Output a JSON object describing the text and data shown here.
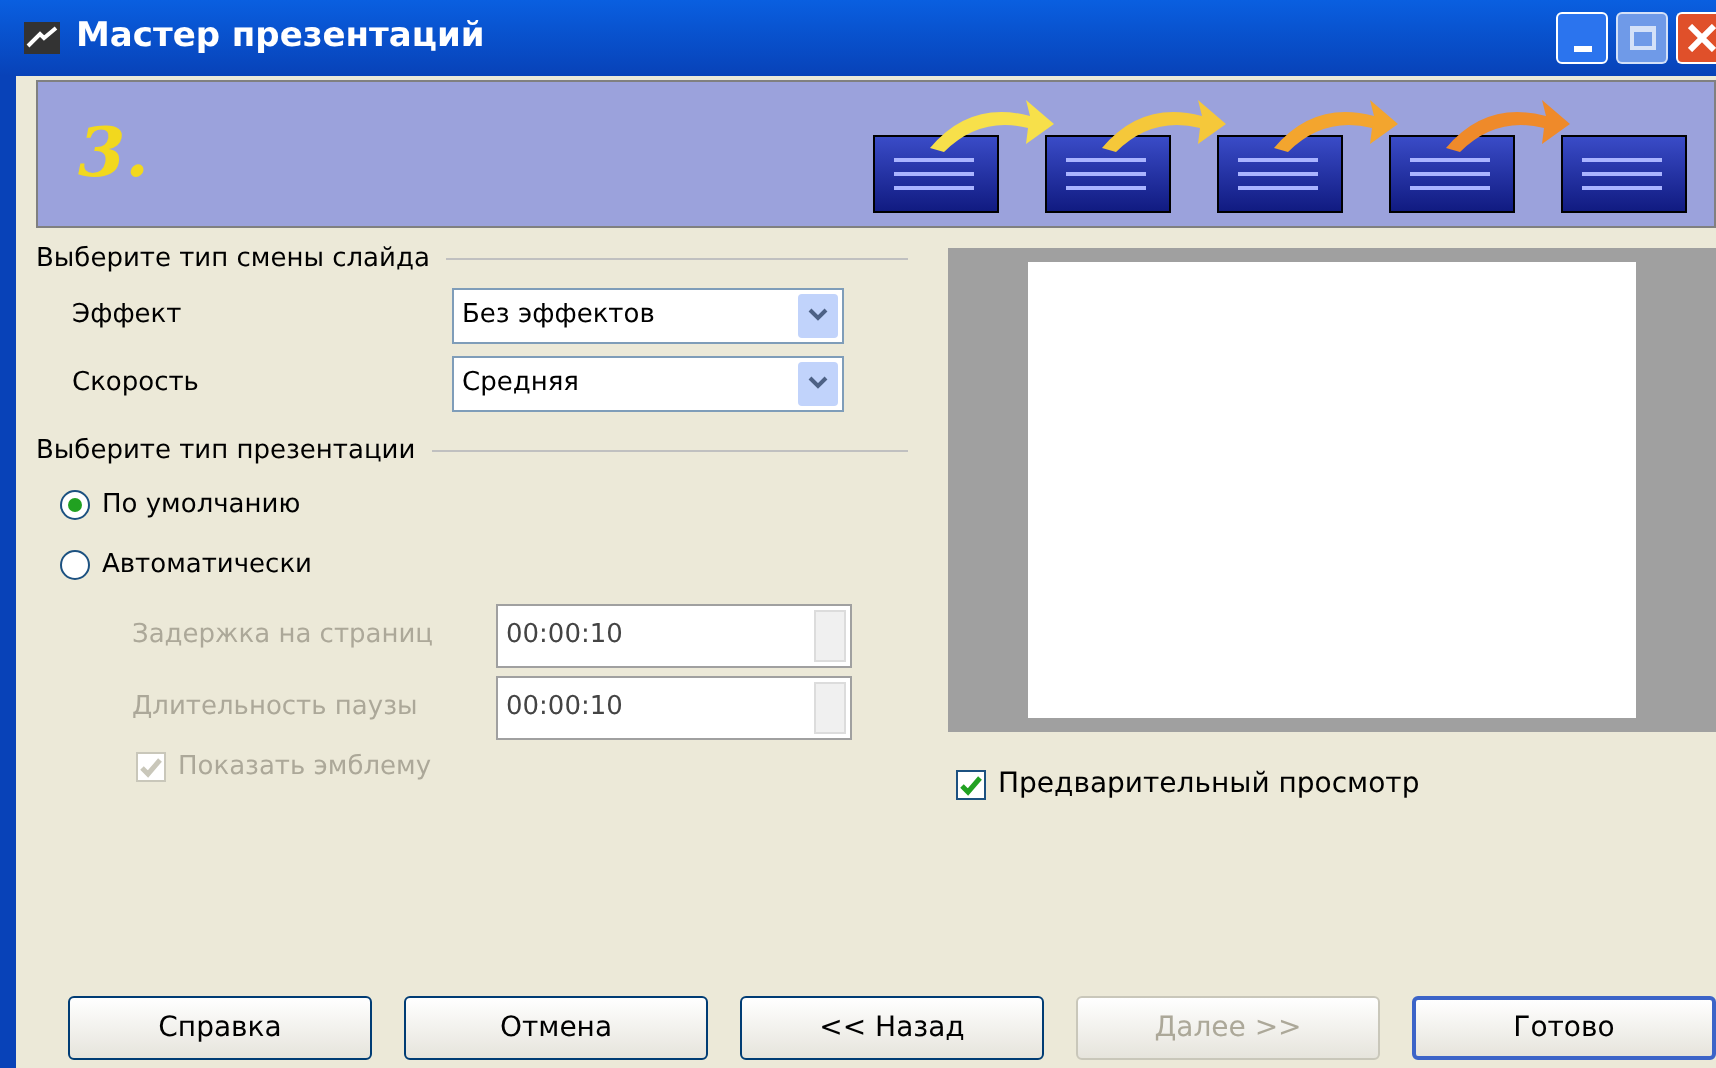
{
  "window": {
    "title": "Мастер презентаций"
  },
  "step": "3.",
  "transition": {
    "heading": "Выберите тип смены слайда",
    "fields": [
      {
        "label": "Эффект",
        "value": "Без эффектов"
      },
      {
        "label": "Скорость",
        "value": "Средняя"
      }
    ]
  },
  "presentation": {
    "heading": "Выберите тип презентации",
    "options": [
      {
        "label": "По умолчанию",
        "selected": true
      },
      {
        "label": "Автоматически",
        "selected": false
      }
    ],
    "timings": [
      {
        "label": "Задержка на страниц",
        "value": "00:00:10",
        "disabled": true
      },
      {
        "label": "Длительность паузы",
        "value": "00:00:10",
        "disabled": true
      }
    ],
    "logo": {
      "label": "Показать эмблему",
      "checked": true,
      "disabled": true
    }
  },
  "preview": {
    "label": "Предварительный просмотр",
    "checked": true
  },
  "buttons": [
    {
      "label": "Справка",
      "disabled": false,
      "default": false
    },
    {
      "label": "Отмена",
      "disabled": false,
      "default": false
    },
    {
      "label": "<< Назад",
      "disabled": false,
      "default": false
    },
    {
      "label": "Далее >>",
      "disabled": true,
      "default": false
    },
    {
      "label": "Готово",
      "disabled": false,
      "default": true
    }
  ]
}
